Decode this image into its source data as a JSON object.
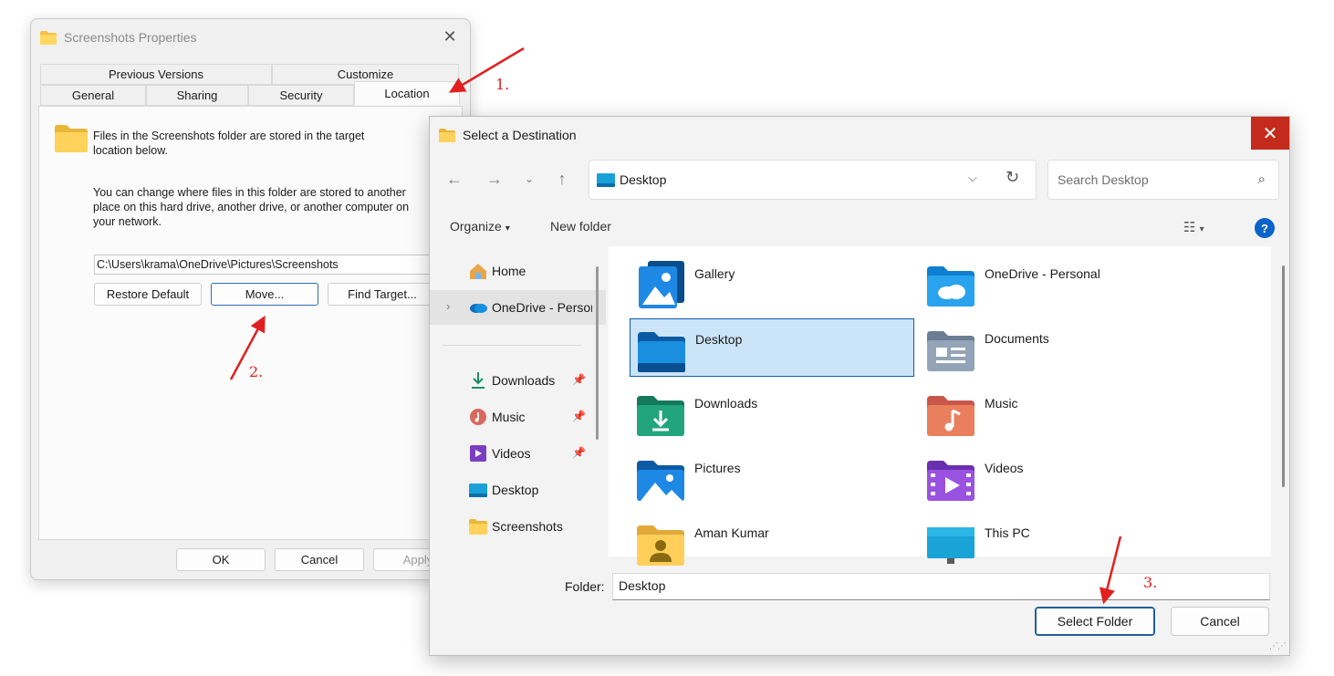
{
  "props": {
    "title": "Screenshots Properties",
    "tabs_row1": [
      "Previous Versions",
      "Customize"
    ],
    "tabs_row2": [
      "General",
      "Sharing",
      "Security",
      "Location"
    ],
    "desc1": "Files in the Screenshots folder are stored in the target location below.",
    "desc2": "You can change where files in this folder are stored to another place on this hard drive, another drive, or another computer on your network.",
    "path": "C:\\Users\\krama\\OneDrive\\Pictures\\Screenshots",
    "restore_label": "Restore Default",
    "move_label": "Move...",
    "find_label": "Find Target...",
    "ok_label": "OK",
    "cancel_label": "Cancel",
    "apply_label": "Apply"
  },
  "dialog": {
    "title": "Select a Destination",
    "address": "Desktop",
    "search_placeholder": "Search Desktop",
    "organize_label": "Organize",
    "newfolder_label": "New folder",
    "nav_items": [
      {
        "label": "Home"
      },
      {
        "label": "OneDrive - Personal"
      },
      {
        "label": "Downloads"
      },
      {
        "label": "Music"
      },
      {
        "label": "Videos"
      },
      {
        "label": "Desktop"
      },
      {
        "label": "Screenshots"
      }
    ],
    "tiles": [
      {
        "label": "Gallery"
      },
      {
        "label": "OneDrive - Personal"
      },
      {
        "label": "Desktop"
      },
      {
        "label": "Documents"
      },
      {
        "label": "Downloads"
      },
      {
        "label": "Music"
      },
      {
        "label": "Pictures"
      },
      {
        "label": "Videos"
      },
      {
        "label": "Aman Kumar"
      },
      {
        "label": "This PC"
      }
    ],
    "folder_label": "Folder:",
    "folder_value": "Desktop",
    "select_label": "Select Folder",
    "cancel_label": "Cancel"
  },
  "annotations": [
    "1.",
    "2.",
    "3."
  ],
  "colors": {
    "annotation": "#e02020",
    "selection": "#cce4f7",
    "close_red": "#c42b1c",
    "accent": "#0a64c8"
  }
}
